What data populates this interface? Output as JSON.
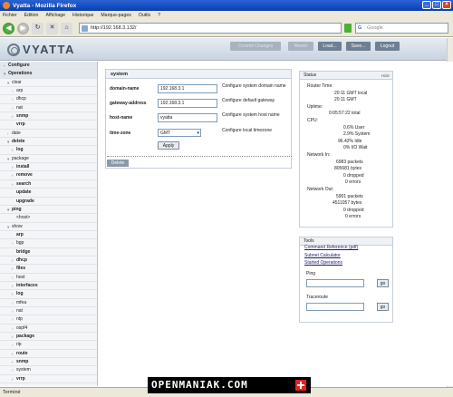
{
  "window": {
    "title": "Vyatta - Mozilla Firefox",
    "min": "_",
    "max": "□",
    "close": "×"
  },
  "menu": [
    "Fichier",
    "Édition",
    "Affichage",
    "Historique",
    "Marque-pages",
    "Outils",
    "?"
  ],
  "nav": {
    "url": "http://192.168.3.132/",
    "search_placeholder": "Google",
    "back": "◀",
    "forward": "▶",
    "reload": "↻",
    "stop": "✕",
    "home": "⌂"
  },
  "header": {
    "logo": "VYATTA",
    "buttons": {
      "commit": "Commit Changes",
      "revert": "Revert",
      "load": "Load...",
      "save": "Save...",
      "logout": "Logout"
    }
  },
  "sidebar": {
    "items": [
      {
        "label": "Configure",
        "bold": true,
        "arrow": "›",
        "indent": 0
      },
      {
        "label": "Operations",
        "bold": true,
        "arrow": "▾",
        "indent": 0
      },
      {
        "label": "clear",
        "bold": false,
        "arrow": "▾",
        "indent": 1
      },
      {
        "label": "arp",
        "bold": false,
        "arrow": "›",
        "indent": 2
      },
      {
        "label": "dhcp",
        "bold": false,
        "arrow": "›",
        "indent": 2
      },
      {
        "label": "nat",
        "bold": false,
        "arrow": "›",
        "indent": 2
      },
      {
        "label": "snmp",
        "bold": true,
        "arrow": "›",
        "indent": 2
      },
      {
        "label": "vrrp",
        "bold": true,
        "arrow": "",
        "indent": 2
      },
      {
        "label": "date",
        "bold": false,
        "arrow": "›",
        "indent": 1
      },
      {
        "label": "delete",
        "bold": true,
        "arrow": "▾",
        "indent": 1
      },
      {
        "label": "log",
        "bold": true,
        "arrow": "›",
        "indent": 2
      },
      {
        "label": "package",
        "bold": false,
        "arrow": "▾",
        "indent": 1
      },
      {
        "label": "install",
        "bold": true,
        "arrow": "›",
        "indent": 2
      },
      {
        "label": "remove",
        "bold": true,
        "arrow": "›",
        "indent": 2
      },
      {
        "label": "search",
        "bold": true,
        "arrow": "›",
        "indent": 2
      },
      {
        "label": "update",
        "bold": true,
        "arrow": "",
        "indent": 2
      },
      {
        "label": "upgrade",
        "bold": true,
        "arrow": "",
        "indent": 2
      },
      {
        "label": "ping",
        "bold": true,
        "arrow": "▾",
        "indent": 1
      },
      {
        "label": "<host>",
        "bold": false,
        "arrow": "",
        "indent": 2
      },
      {
        "label": "show",
        "bold": false,
        "arrow": "▾",
        "indent": 1
      },
      {
        "label": "arp",
        "bold": true,
        "arrow": "",
        "indent": 2
      },
      {
        "label": "bgp",
        "bold": false,
        "arrow": "›",
        "indent": 2
      },
      {
        "label": "bridge",
        "bold": true,
        "arrow": "",
        "indent": 2
      },
      {
        "label": "dhcp",
        "bold": true,
        "arrow": "›",
        "indent": 2
      },
      {
        "label": "files",
        "bold": true,
        "arrow": "›",
        "indent": 2
      },
      {
        "label": "host",
        "bold": false,
        "arrow": "›",
        "indent": 2
      },
      {
        "label": "interfaces",
        "bold": true,
        "arrow": "›",
        "indent": 2
      },
      {
        "label": "log",
        "bold": true,
        "arrow": "›",
        "indent": 2
      },
      {
        "label": "mfea",
        "bold": false,
        "arrow": "›",
        "indent": 2
      },
      {
        "label": "nat",
        "bold": false,
        "arrow": "›",
        "indent": 2
      },
      {
        "label": "ntp",
        "bold": false,
        "arrow": "›",
        "indent": 2
      },
      {
        "label": "ospf4",
        "bold": false,
        "arrow": "›",
        "indent": 2
      },
      {
        "label": "package",
        "bold": true,
        "arrow": "›",
        "indent": 2
      },
      {
        "label": "rip",
        "bold": false,
        "arrow": "›",
        "indent": 2
      },
      {
        "label": "route",
        "bold": true,
        "arrow": "›",
        "indent": 2
      },
      {
        "label": "snmp",
        "bold": true,
        "arrow": "›",
        "indent": 2
      },
      {
        "label": "system",
        "bold": false,
        "arrow": "›",
        "indent": 2
      },
      {
        "label": "vrrp",
        "bold": true,
        "arrow": "›",
        "indent": 2
      }
    ]
  },
  "system": {
    "title": "system",
    "fields": [
      {
        "label": "domain-name",
        "value": "192.168.3.1",
        "desc": "Configure system domain name"
      },
      {
        "label": "gateway-address",
        "value": "192.168.3.1",
        "desc": "Configure default gateway"
      },
      {
        "label": "host-name",
        "value": "vyatta",
        "desc": "Configure system host name"
      },
      {
        "label": "time-zone",
        "value": "GMT",
        "desc": "Configure local timezone"
      }
    ],
    "apply": "Apply",
    "delete": "Delete"
  },
  "status": {
    "title": "Status",
    "hide": "Hide",
    "lines": [
      {
        "t": "Router Time:",
        "x": 0
      },
      {
        "t": "20:11 GMT local",
        "x": 30
      },
      {
        "t": "20:11 GMT",
        "x": 30
      },
      {
        "t": "Uptime:",
        "x": 0
      },
      {
        "t": "0:05:57:22 total",
        "x": 24
      },
      {
        "t": "CPU:",
        "x": 0
      },
      {
        "t": "0.6% User",
        "x": 40
      },
      {
        "t": "2.9% System",
        "x": 40
      },
      {
        "t": "96.42% Idle",
        "x": 34
      },
      {
        "t": "0% I/O Wait",
        "x": 40
      },
      {
        "t": "Network In:",
        "x": 0
      },
      {
        "t": "6983 packets",
        "x": 32
      },
      {
        "t": "805681 bytes",
        "x": 30
      },
      {
        "t": "0 dropped",
        "x": 40
      },
      {
        "t": "0 errors",
        "x": 42
      },
      {
        "t": "Network Out:",
        "x": 0
      },
      {
        "t": "5901 packets",
        "x": 32
      },
      {
        "t": "4511057 bytes",
        "x": 28
      },
      {
        "t": "0 dropped",
        "x": 40
      },
      {
        "t": "0 errors",
        "x": 42
      }
    ]
  },
  "tools": {
    "title": "Tools",
    "links": [
      "Command Reference (pdf)",
      "Subnet Calculator",
      "Started Operations"
    ],
    "ping": "Ping",
    "traceroute": "Traceroute",
    "go": "go"
  },
  "statusbar": "Terminé",
  "watermark": "OPENMANIAK.COM"
}
